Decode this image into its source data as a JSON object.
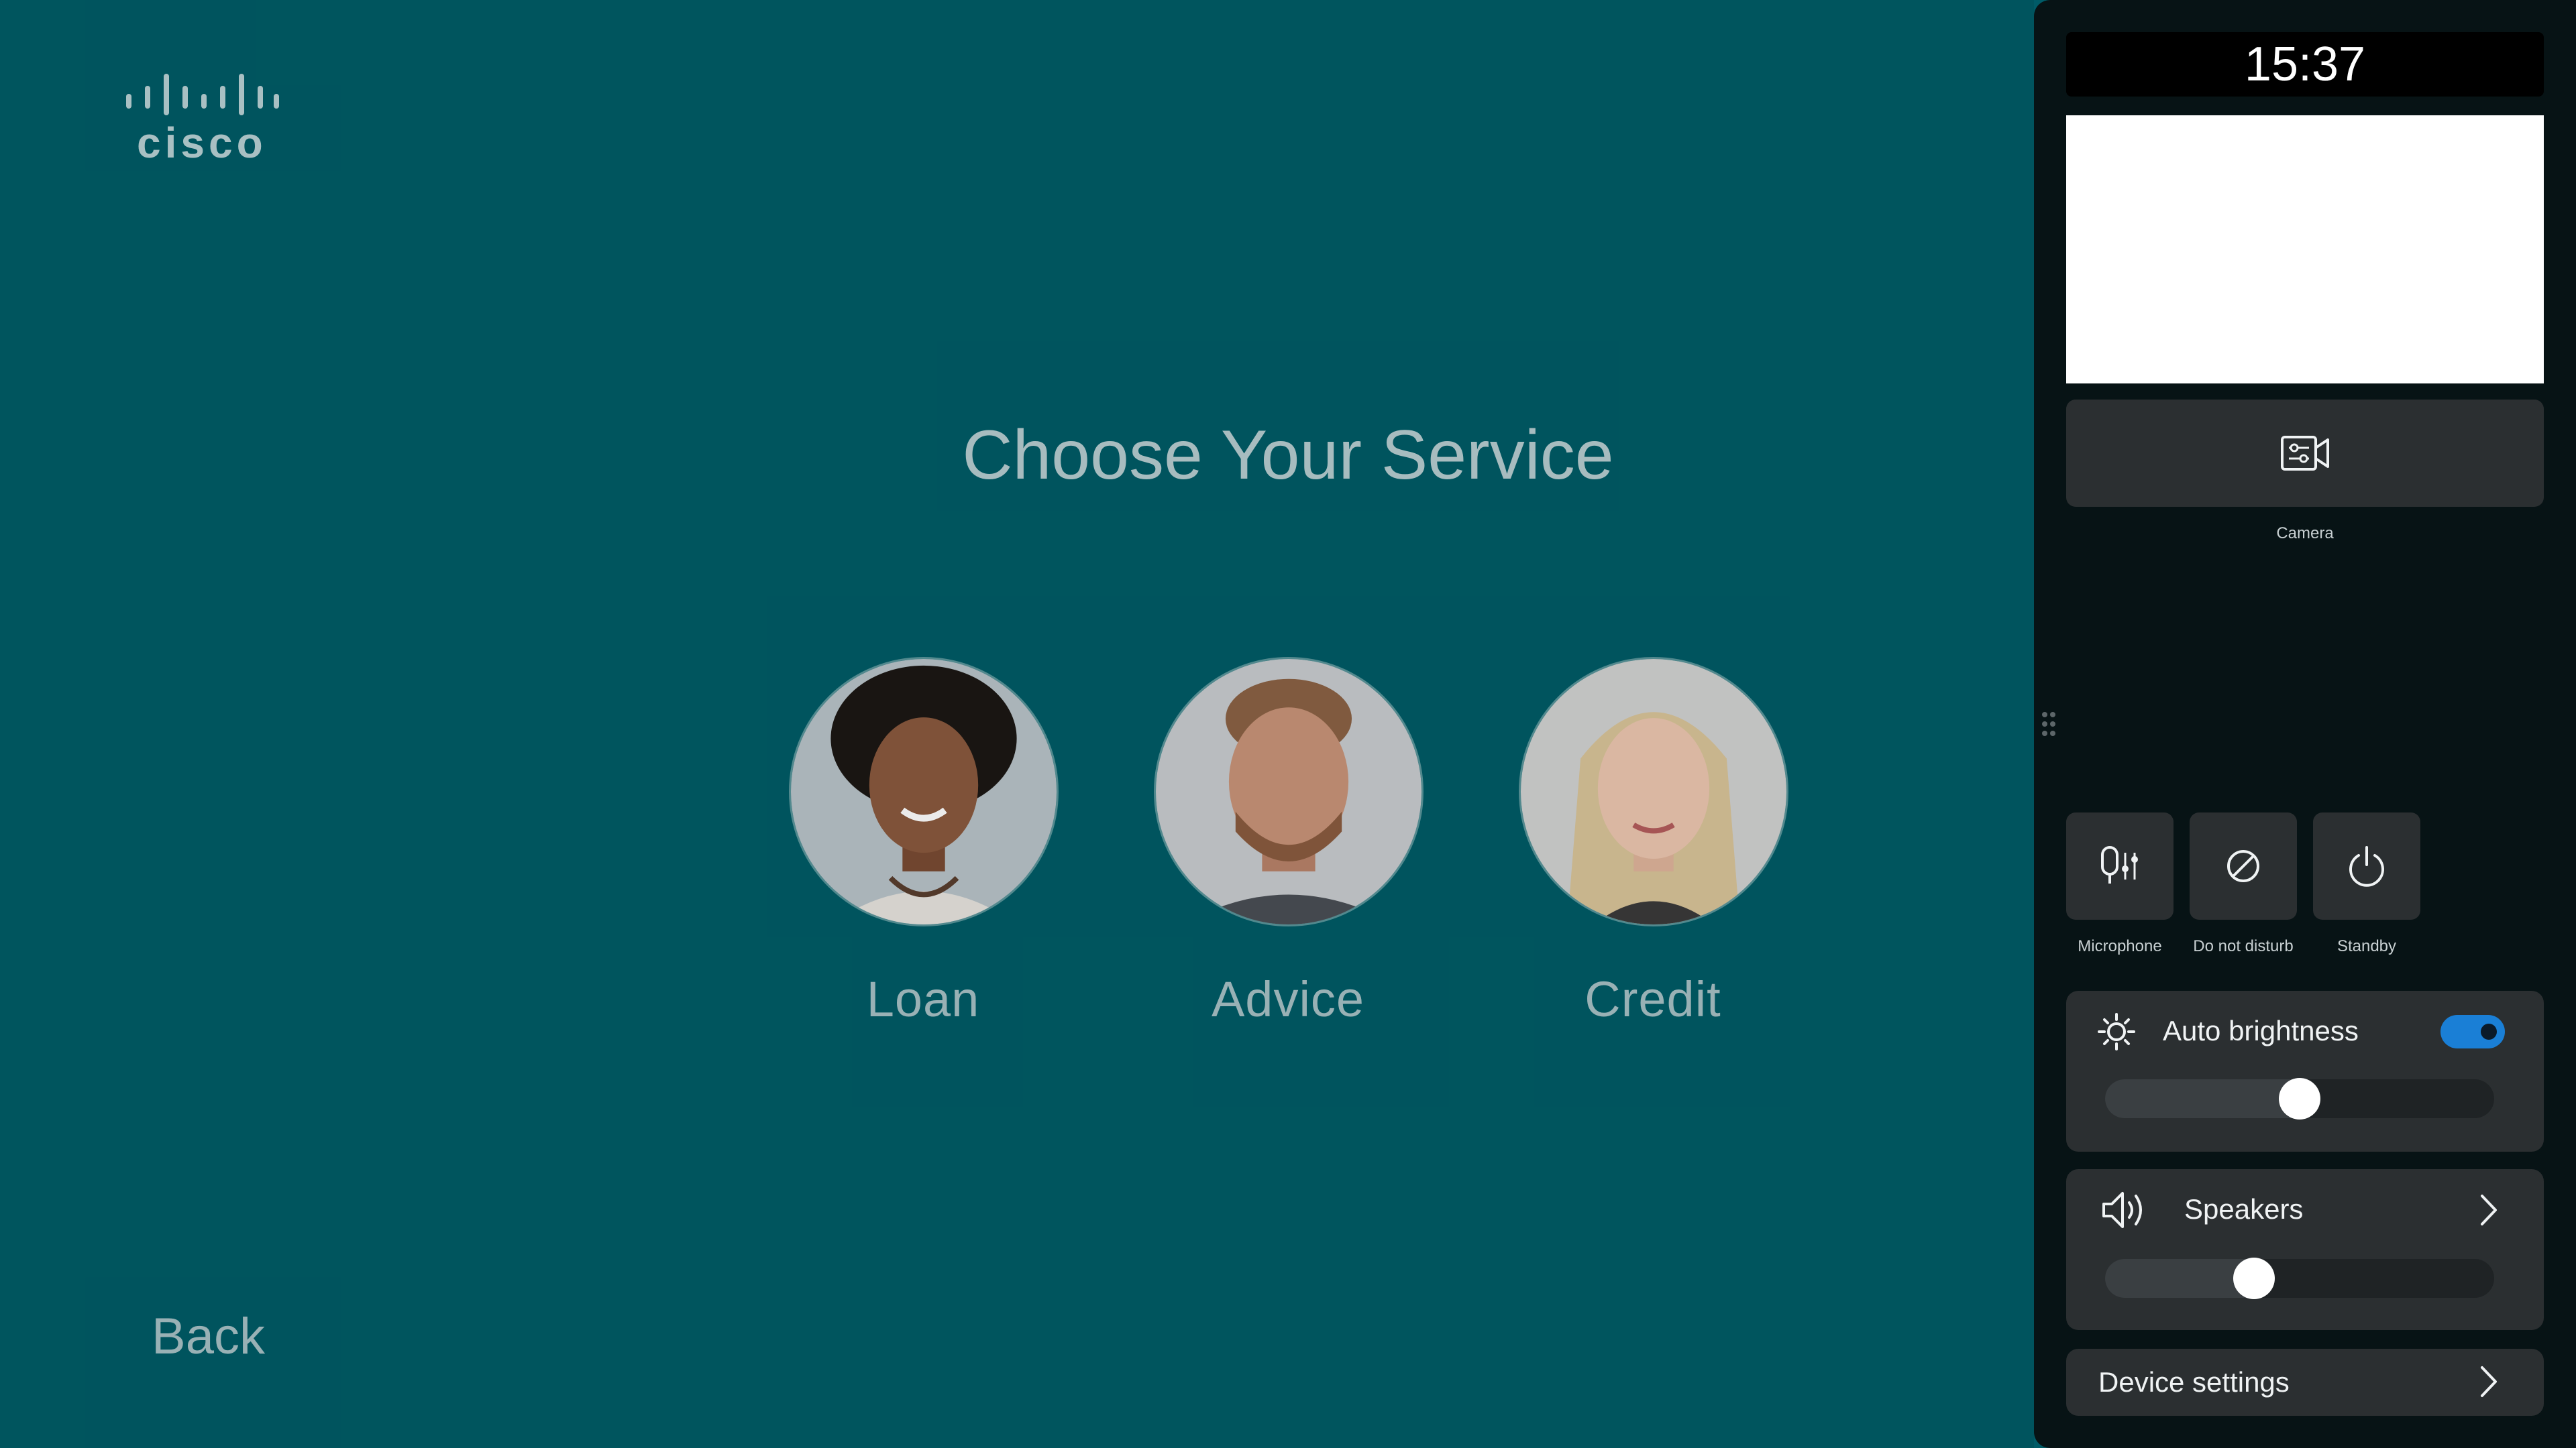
{
  "brand": {
    "logo_text": "cisco"
  },
  "main": {
    "title": "Choose Your Service",
    "services": [
      {
        "label": "Loan"
      },
      {
        "label": "Advice"
      },
      {
        "label": "Credit"
      }
    ],
    "back_label": "Back"
  },
  "panel": {
    "time": "15:37",
    "camera_label": "Camera",
    "quick_actions": [
      {
        "label": "Microphone",
        "icon": "microphone-icon"
      },
      {
        "label": "Do not disturb",
        "icon": "do-not-disturb-icon"
      },
      {
        "label": "Standby",
        "icon": "power-icon"
      }
    ],
    "brightness": {
      "label": "Auto brightness",
      "auto_enabled": true,
      "level": 0.5
    },
    "speakers": {
      "label": "Speakers",
      "level": 0.38
    },
    "device_settings_label": "Device settings"
  },
  "colors": {
    "background": "#005c66",
    "panel": "#071315",
    "card": "#2b2f31",
    "toggle_on": "#1a7fd6",
    "text_muted": "#a7c1c5"
  }
}
